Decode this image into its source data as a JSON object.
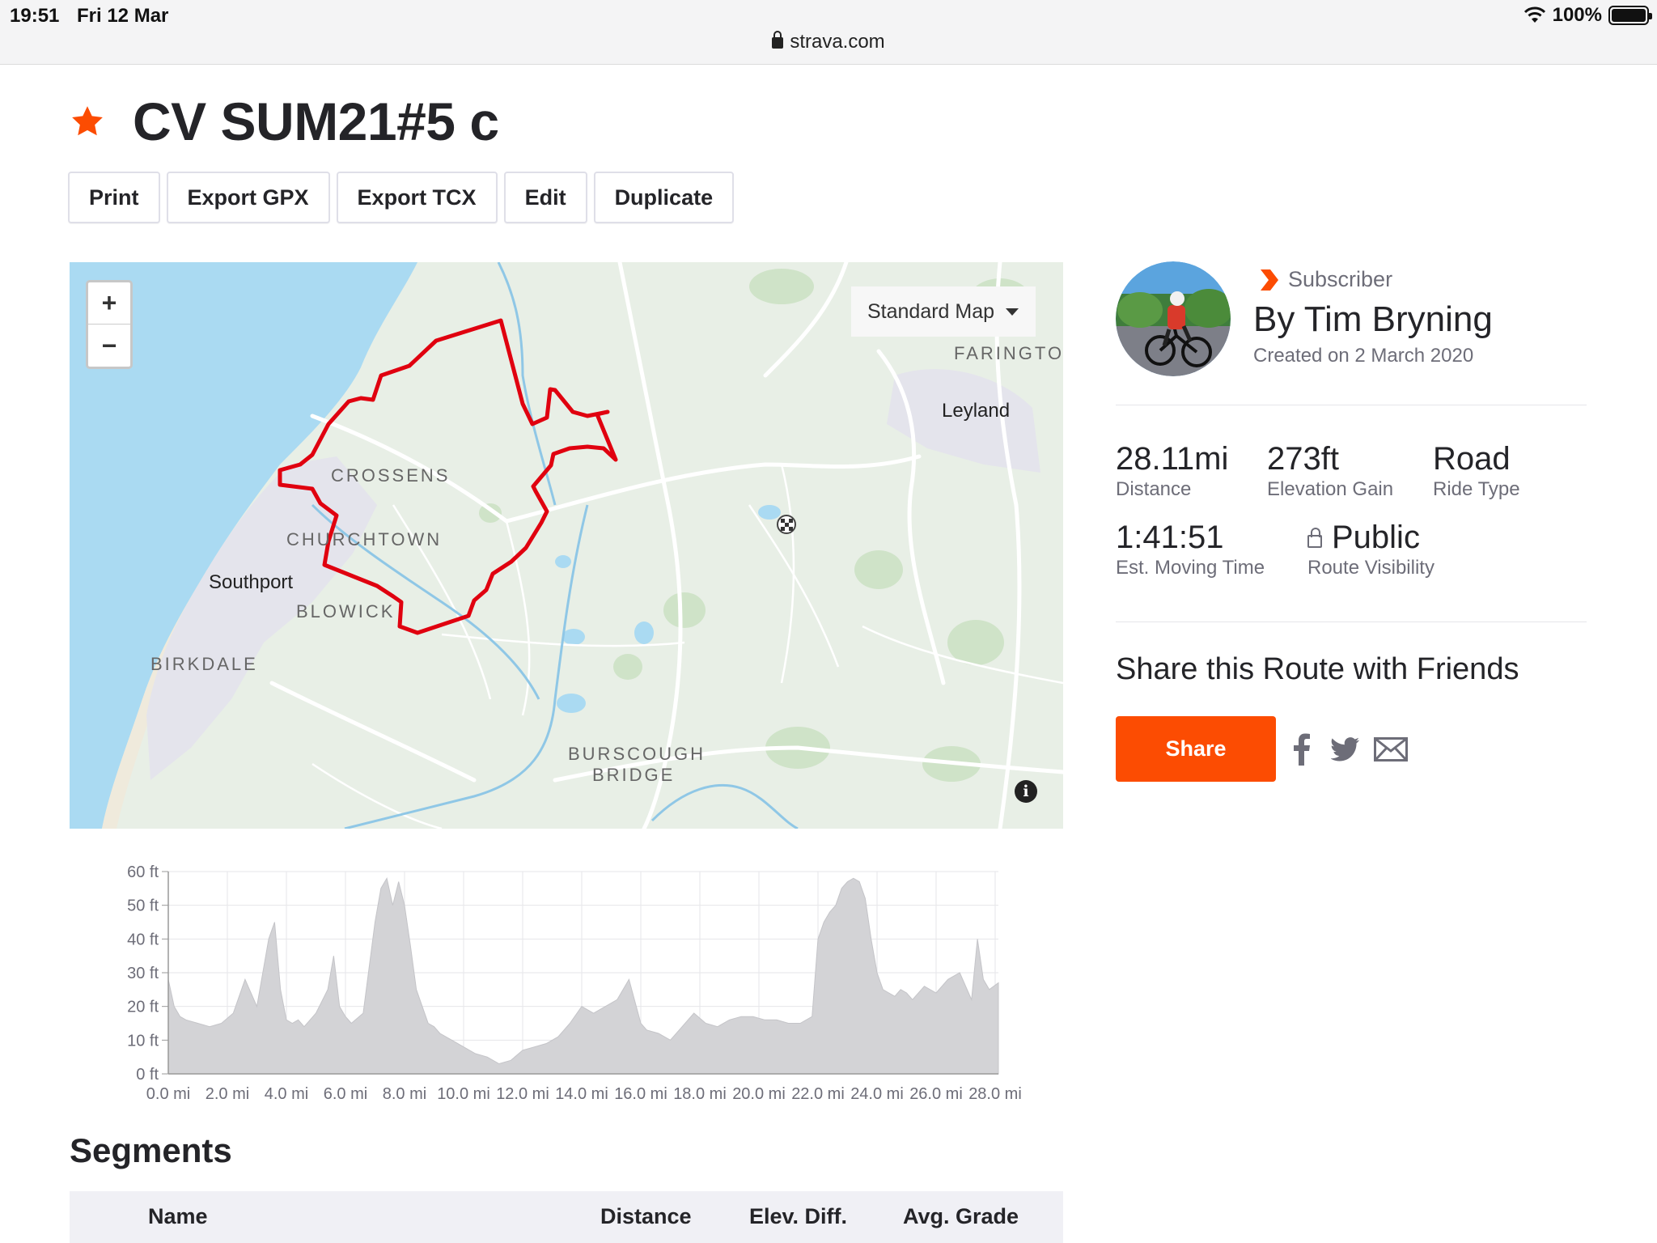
{
  "status_bar": {
    "time": "19:51",
    "date": "Fri 12 Mar",
    "battery": "100%"
  },
  "browser": {
    "url": "strava.com"
  },
  "route": {
    "title": "CV SUM21#5 c"
  },
  "toolbar": {
    "print": "Print",
    "export_gpx": "Export GPX",
    "export_tcx": "Export TCX",
    "edit": "Edit",
    "duplicate": "Duplicate"
  },
  "map": {
    "type_selector": "Standard Map",
    "zoom_in": "+",
    "zoom_out": "−",
    "info": "i",
    "route_color": "#e0000f",
    "labels": {
      "farington": "FARINGTON",
      "leyland": "Leyland",
      "crossens": "CROSSENS",
      "churchtown": "CHURCHTOWN",
      "southport": "Southport",
      "blowick": "BLOWICK",
      "birkdale": "BIRKDALE",
      "burscough": "BURSCOUGH",
      "bridge": "BRIDGE"
    }
  },
  "chart_data": {
    "type": "area",
    "title": "",
    "xlabel": "",
    "ylabel": "",
    "xlim": [
      0,
      28.11
    ],
    "ylim": [
      0,
      60
    ],
    "x_ticks": [
      "0.0 mi",
      "2.0 mi",
      "4.0 mi",
      "6.0 mi",
      "8.0 mi",
      "10.0 mi",
      "12.0 mi",
      "14.0 mi",
      "16.0 mi",
      "18.0 mi",
      "20.0 mi",
      "22.0 mi",
      "24.0 mi",
      "26.0 mi",
      "28.0 mi"
    ],
    "y_ticks": [
      "0 ft",
      "10 ft",
      "20 ft",
      "30 ft",
      "40 ft",
      "50 ft",
      "60 ft"
    ],
    "x": [
      0.0,
      0.2,
      0.4,
      0.6,
      1.0,
      1.4,
      1.8,
      2.2,
      2.6,
      3.0,
      3.4,
      3.6,
      3.8,
      4.0,
      4.2,
      4.4,
      4.6,
      5.0,
      5.4,
      5.6,
      5.8,
      6.0,
      6.2,
      6.6,
      7.0,
      7.2,
      7.4,
      7.6,
      7.8,
      8.0,
      8.2,
      8.4,
      8.6,
      8.8,
      9.0,
      9.2,
      9.6,
      10.0,
      10.4,
      10.8,
      11.2,
      11.6,
      12.0,
      12.4,
      12.8,
      13.2,
      13.6,
      14.0,
      14.4,
      14.8,
      15.2,
      15.6,
      16.0,
      16.2,
      16.6,
      17.0,
      17.4,
      17.8,
      18.2,
      18.6,
      19.0,
      19.4,
      19.8,
      20.2,
      20.6,
      21.0,
      21.4,
      21.8,
      22.0,
      22.2,
      22.4,
      22.6,
      22.8,
      23.0,
      23.2,
      23.4,
      23.6,
      23.8,
      24.0,
      24.2,
      24.4,
      24.6,
      24.8,
      25.0,
      25.2,
      25.6,
      26.0,
      26.4,
      26.8,
      27.2,
      27.4,
      27.6,
      27.8,
      28.11
    ],
    "y": [
      28,
      20,
      17,
      16,
      15,
      14,
      15,
      18,
      28,
      20,
      40,
      45,
      25,
      16,
      15,
      16,
      14,
      18,
      25,
      35,
      20,
      17,
      15,
      18,
      45,
      55,
      58,
      50,
      57,
      50,
      38,
      25,
      20,
      15,
      14,
      12,
      10,
      8,
      6,
      5,
      3,
      4,
      7,
      8,
      9,
      11,
      15,
      20,
      18,
      20,
      22,
      28,
      15,
      13,
      12,
      10,
      14,
      18,
      15,
      14,
      16,
      17,
      17,
      16,
      16,
      15,
      15,
      17,
      40,
      45,
      48,
      50,
      55,
      57,
      58,
      57,
      52,
      40,
      30,
      25,
      24,
      23,
      25,
      24,
      22,
      26,
      24,
      28,
      30,
      22,
      40,
      28,
      25,
      27
    ]
  },
  "segments": {
    "title": "Segments",
    "columns": [
      "Name",
      "Distance",
      "Elev. Diff.",
      "Avg. Grade"
    ]
  },
  "author": {
    "badge": "Subscriber",
    "name": "By Tim Bryning",
    "created": "Created on 2 March 2020"
  },
  "stats": {
    "distance": {
      "value": "28.11mi",
      "label": "Distance"
    },
    "elevation": {
      "value": "273ft",
      "label": "Elevation Gain"
    },
    "type": {
      "value": "Road",
      "label": "Ride Type"
    },
    "time": {
      "value": "1:41:51",
      "label": "Est. Moving Time"
    },
    "visibility": {
      "value": "Public",
      "label": "Route Visibility"
    }
  },
  "share": {
    "title": "Share this Route with Friends",
    "button": "Share"
  },
  "colors": {
    "accent": "#fc4c02",
    "route": "#e0000f",
    "water": "#aadaf2",
    "land": "#e8efe6"
  }
}
